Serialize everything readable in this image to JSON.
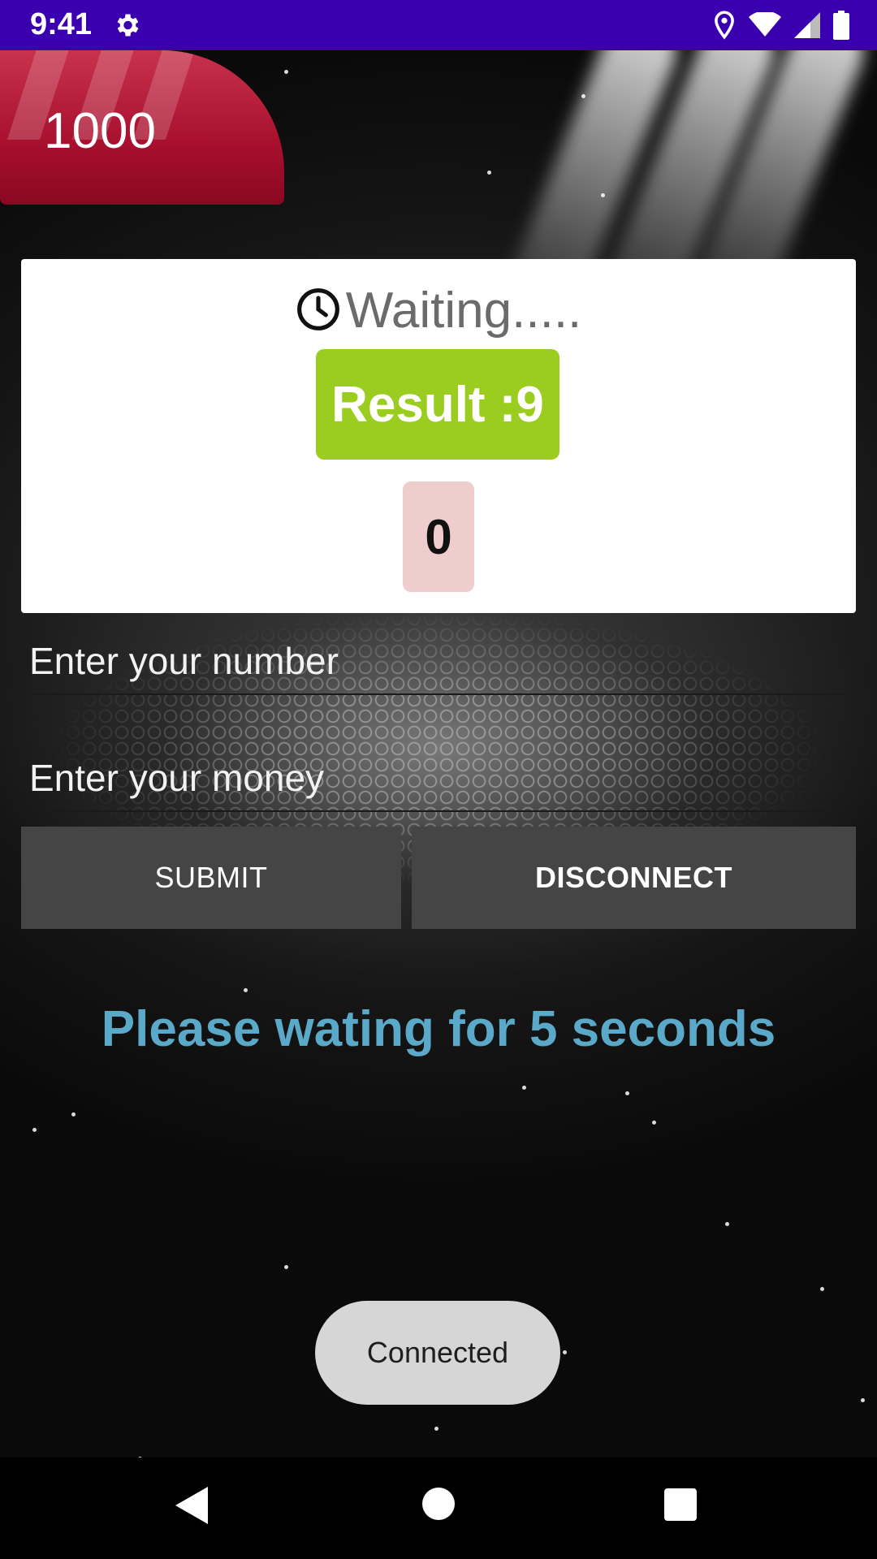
{
  "status_bar": {
    "time": "9:41",
    "icons": [
      "gear-icon",
      "location-icon",
      "wifi-icon",
      "signal-icon",
      "battery-icon"
    ]
  },
  "coins": {
    "value": "1000"
  },
  "card": {
    "waiting_text": "Waiting.....",
    "result_text": "Result :9",
    "counter_value": "0"
  },
  "form": {
    "number_placeholder": "Enter your number",
    "money_placeholder": "Enter your money",
    "submit_label": "SUBMIT",
    "disconnect_label": "DISCONNECT"
  },
  "message": "Please wating for 5 seconds",
  "toast": "Connected",
  "nav": {
    "icons": [
      "back-icon",
      "home-icon",
      "recents-icon"
    ]
  },
  "colors": {
    "status_bar": "#3a00b0",
    "coin_badge": "#a8102e",
    "result_box": "#9acd1f",
    "counter_box": "#efcdcd",
    "button": "#454545",
    "message": "#5aa9c8",
    "toast": "#d6d6d6"
  }
}
